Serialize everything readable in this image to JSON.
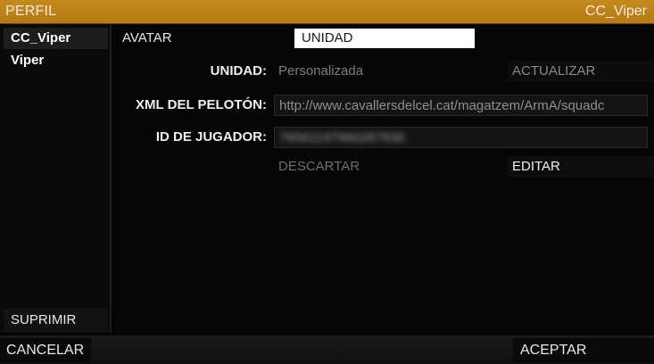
{
  "window": {
    "title": "PERFIL",
    "profile_name": "CC_Viper"
  },
  "profiles": {
    "items": [
      {
        "label": "CC_Viper",
        "selected": true
      },
      {
        "label": "Viper",
        "selected": false
      }
    ],
    "delete_label": "SUPRIMIR"
  },
  "tabs": {
    "avatar": "AVATAR",
    "unidad": "UNIDAD",
    "active": "UNIDAD"
  },
  "form": {
    "unit_label": "UNIDAD:",
    "unit_value": "Personalizada",
    "refresh_label": "ACTUALIZAR",
    "xml_label": "XML DEL PELOTÓN:",
    "xml_value": "http://www.cavallersdelcel.cat/magatzem/ArmA/squadc",
    "player_id_label": "ID DE JUGADOR:",
    "player_id_value": "76561197960287930",
    "discard_label": "DESCARTAR",
    "edit_label": "EDITAR"
  },
  "footer": {
    "cancel_label": "CANCELAR",
    "accept_label": "ACEPTAR"
  },
  "colors": {
    "accent": "#c58a1e",
    "tab_active_bg": "#ffffff",
    "background": "#050505"
  }
}
